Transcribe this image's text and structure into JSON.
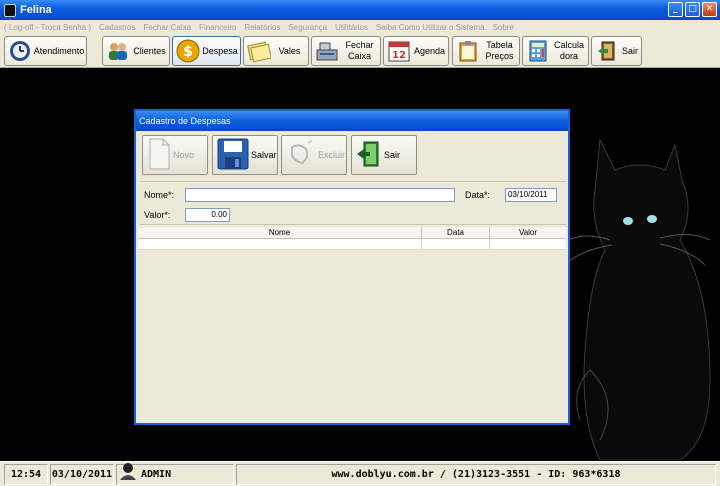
{
  "window": {
    "title": "Felina"
  },
  "menu": [
    "( Log-off - Troca Senha )",
    "Cadastros",
    "Fechar Caixa",
    "Financeiro",
    "Relatórios",
    "Segurança",
    "Utilitários",
    "Saiba Como Utilizar o Sistema",
    "Sobre"
  ],
  "toolbar": {
    "atendimento": "Atendimento",
    "clientes": "Clientes",
    "despesa": "Despesa",
    "vales": "Vales",
    "fechar_caixa_1": "Fechar",
    "fechar_caixa_2": "Caixa",
    "agenda": "Agenda",
    "tabela_1": "Tabela",
    "tabela_2": "Preços",
    "calculadora_1": "Calcula",
    "calculadora_2": "dora",
    "sair": "Sair"
  },
  "dialog": {
    "title": "Cadastro de Despesas",
    "buttons": {
      "novo": "Novo",
      "salvar": "Salvar",
      "excluir": "Excluir",
      "sair": "Sair"
    },
    "fields": {
      "nome_label": "Nome*:",
      "nome_value": "",
      "data_label": "Data*:",
      "data_value": "03/10/2011",
      "valor_label": "Valor*:",
      "valor_value": "0.00"
    },
    "grid": {
      "columns": [
        "Nome",
        "Data",
        "Valor"
      ]
    }
  },
  "statusbar": {
    "time": "12:54",
    "date": "03/10/2011",
    "user": "ADMIN",
    "contact": "www.doblyu.com.br / (21)3123-3551 - ID: 963*6318"
  },
  "colors": {
    "titlebar": "#0a5fe0",
    "chrome": "#ece9d8",
    "background": "#000000"
  }
}
